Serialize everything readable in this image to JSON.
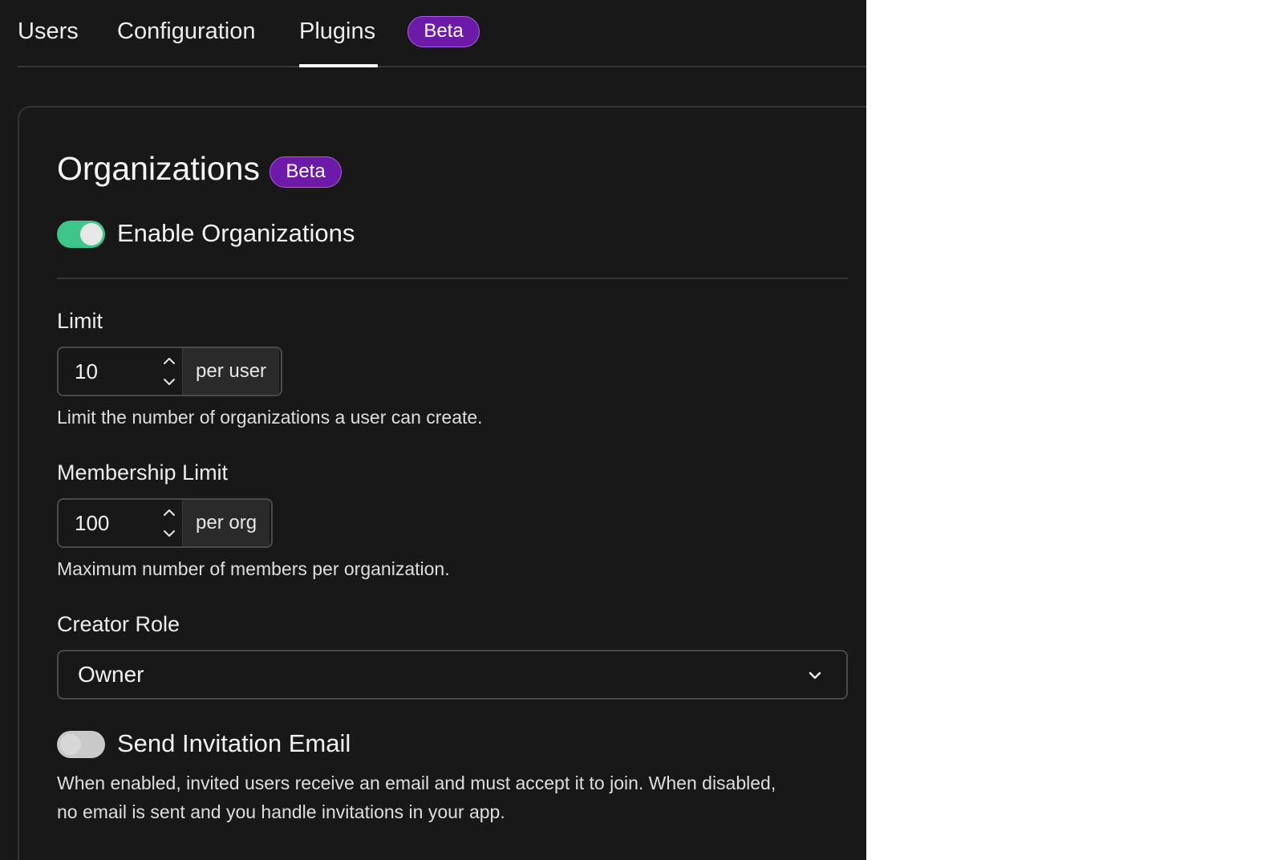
{
  "tabs": {
    "users": "Users",
    "configuration": "Configuration",
    "plugins": "Plugins",
    "plugins_badge": "Beta",
    "active": "plugins"
  },
  "section": {
    "title": "Organizations",
    "badge": "Beta"
  },
  "enable_organizations": {
    "label": "Enable Organizations",
    "enabled": true
  },
  "limit": {
    "label": "Limit",
    "value": "10",
    "unit": "per user",
    "help": "Limit the number of organizations a user can create."
  },
  "membership_limit": {
    "label": "Membership Limit",
    "value": "100",
    "unit": "per org",
    "help": "Maximum number of members per organization."
  },
  "creator_role": {
    "label": "Creator Role",
    "selected": "Owner"
  },
  "send_invitation_email": {
    "label": "Send Invitation Email",
    "enabled": false,
    "help_line1": "When enabled, invited users receive an email and must accept it to join. When disabled,",
    "help_line2": "no email is sent and you handle invitations in your app."
  },
  "colors": {
    "background": "#181818",
    "badge": "#6e1aa8",
    "toggle_on": "#3fc48a"
  }
}
